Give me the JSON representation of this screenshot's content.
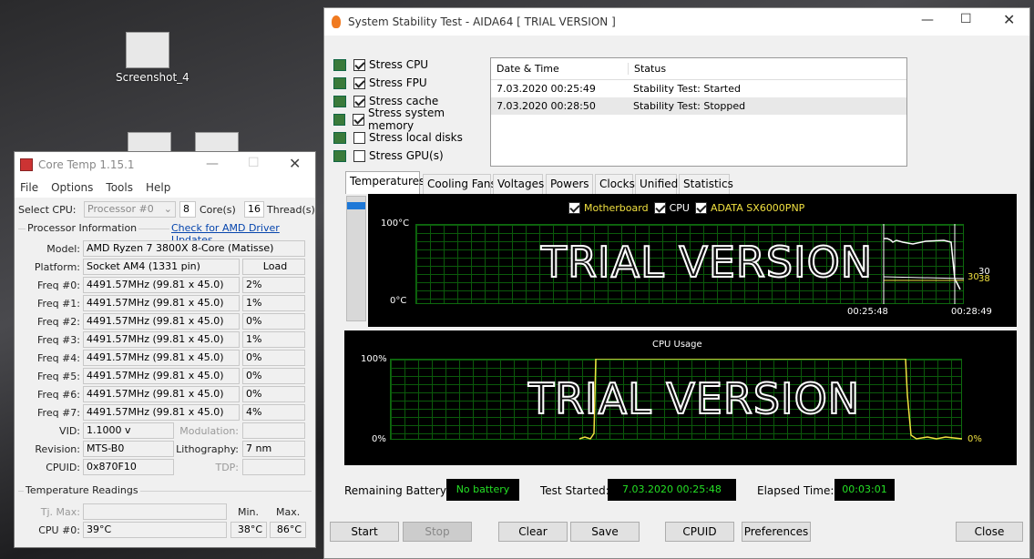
{
  "desktop": {
    "icons": [
      {
        "label": "Screenshot_4"
      }
    ]
  },
  "coretemp": {
    "title": "Core Temp 1.15.1",
    "menu": [
      "File",
      "Options",
      "Tools",
      "Help"
    ],
    "select_cpu_label": "Select CPU:",
    "processor": "Processor #0",
    "cores_value": "8",
    "cores_label": "Core(s)",
    "threads_value": "16",
    "threads_label": "Thread(s)",
    "proc_info_label": "Processor Information",
    "driver_link": "Check for AMD Driver Updates",
    "model_label": "Model:",
    "model": "AMD Ryzen 7 3800X 8-Core (Matisse)",
    "platform_label": "Platform:",
    "platform": "Socket AM4 (1331 pin)",
    "load_header": "Load",
    "freqs": [
      {
        "label": "Freq #0:",
        "value": "4491.57MHz (99.81 x 45.0)",
        "load": "2%"
      },
      {
        "label": "Freq #1:",
        "value": "4491.57MHz (99.81 x 45.0)",
        "load": "1%"
      },
      {
        "label": "Freq #2:",
        "value": "4491.57MHz (99.81 x 45.0)",
        "load": "0%"
      },
      {
        "label": "Freq #3:",
        "value": "4491.57MHz (99.81 x 45.0)",
        "load": "1%"
      },
      {
        "label": "Freq #4:",
        "value": "4491.57MHz (99.81 x 45.0)",
        "load": "0%"
      },
      {
        "label": "Freq #5:",
        "value": "4491.57MHz (99.81 x 45.0)",
        "load": "0%"
      },
      {
        "label": "Freq #6:",
        "value": "4491.57MHz (99.81 x 45.0)",
        "load": "0%"
      },
      {
        "label": "Freq #7:",
        "value": "4491.57MHz (99.81 x 45.0)",
        "load": "4%"
      }
    ],
    "vid_label": "VID:",
    "vid": "1.1000 v",
    "modulation_label": "Modulation:",
    "revision_label": "Revision:",
    "revision": "MTS-B0",
    "lithography_label": "Lithography:",
    "lithography": "7 nm",
    "cpuid_label": "CPUID:",
    "cpuid": "0x870F10",
    "tdp_label": "TDP:",
    "temp_readings_label": "Temperature Readings",
    "tj_max_label": "Tj. Max:",
    "min_header": "Min.",
    "max_header": "Max.",
    "cpu0_label": "CPU #0:",
    "cpu0_temp": "39°C",
    "cpu0_min": "38°C",
    "cpu0_max": "86°C"
  },
  "aida": {
    "title": "System Stability Test - AIDA64  [ TRIAL VERSION ]",
    "stress": [
      {
        "label": "Stress CPU",
        "checked": true,
        "icon": "cpu-chip-icon"
      },
      {
        "label": "Stress FPU",
        "checked": true,
        "icon": "fpu-icon"
      },
      {
        "label": "Stress cache",
        "checked": true,
        "icon": "cache-chip-icon"
      },
      {
        "label": "Stress system memory",
        "checked": true,
        "icon": "memory-module-icon"
      },
      {
        "label": "Stress local disks",
        "checked": false,
        "icon": "disk-drive-icon"
      },
      {
        "label": "Stress GPU(s)",
        "checked": false,
        "icon": "monitor-icon"
      }
    ],
    "log": {
      "headers": [
        "Date & Time",
        "Status"
      ],
      "rows": [
        [
          "7.03.2020 00:25:49",
          "Stability Test: Started"
        ],
        [
          "7.03.2020 00:28:50",
          "Stability Test: Stopped"
        ]
      ]
    },
    "tabs": [
      "Temperatures",
      "Cooling Fans",
      "Voltages",
      "Powers",
      "Clocks",
      "Unified",
      "Statistics"
    ],
    "temp_graph": {
      "legend": [
        {
          "label": "Motherboard",
          "color": "#f0e040"
        },
        {
          "label": "CPU",
          "color": "#ffffff"
        },
        {
          "label": "ADATA SX6000PNP",
          "color": "#f0e040"
        }
      ],
      "y_top": "100°C",
      "y_bottom": "0°C",
      "x_start": "00:25:48",
      "x_end": "00:28:49",
      "watermark": "TRIAL VERSION",
      "end_values": [
        "30",
        "30",
        "38"
      ]
    },
    "cpu_graph": {
      "title": "CPU Usage",
      "y_top": "100%",
      "y_bottom": "0%",
      "watermark": "TRIAL VERSION",
      "end_value": "0%"
    },
    "status": {
      "battery_label": "Remaining Battery:",
      "battery": "No battery",
      "started_label": "Test Started:",
      "started": "7.03.2020 00:25:48",
      "elapsed_label": "Elapsed Time:",
      "elapsed": "00:03:01"
    },
    "buttons": {
      "start": "Start",
      "stop": "Stop",
      "clear": "Clear",
      "save": "Save",
      "cpuid": "CPUID",
      "preferences": "Preferences",
      "close": "Close"
    },
    "colors": {
      "graph_green": "#0b5a0b",
      "status_text": "#25e025",
      "yellow": "#f0e040"
    }
  }
}
